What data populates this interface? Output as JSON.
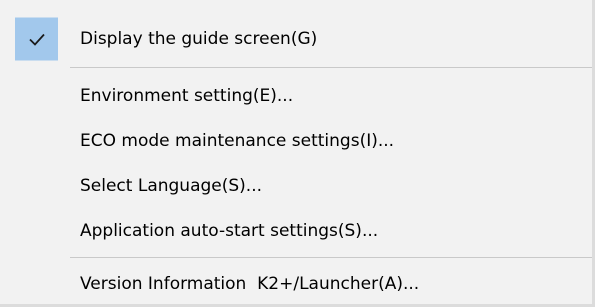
{
  "menu": {
    "items": [
      {
        "label": "Display the guide screen(G)",
        "checked": true,
        "check_icon": "checkmark-icon"
      },
      {
        "label": "Environment setting(E)..."
      },
      {
        "label": "ECO mode maintenance settings(I)..."
      },
      {
        "label": "Select Language(S)..."
      },
      {
        "label": "Application auto-start settings(S)..."
      },
      {
        "label": "Version Information  K2+/Launcher(A)..."
      }
    ],
    "colors": {
      "background": "#f2f2f2",
      "check_highlight": "#a2c8ec",
      "separator": "#c9c9c9",
      "text": "#000000"
    }
  }
}
